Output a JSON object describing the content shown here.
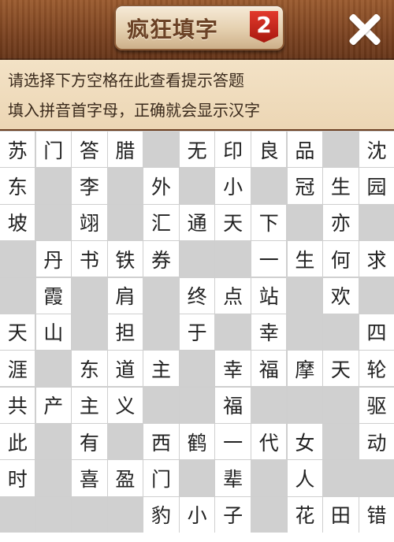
{
  "header": {
    "title": "疯狂填字",
    "badge": "2",
    "close_symbol": "✕"
  },
  "hints": {
    "line1": "请选择下方空格在此查看提示答题",
    "line2": "填入拼音首字母，正确就会显示汉字"
  },
  "grid": {
    "rows": [
      [
        "苏",
        "门",
        "答",
        "腊",
        "",
        "无",
        "印",
        "良",
        "品",
        "",
        "沈"
      ],
      [
        "东",
        "",
        "李",
        "",
        "外",
        "",
        "小",
        "",
        "冠",
        "生",
        "园"
      ],
      [
        "坡",
        "",
        "翊",
        "",
        "汇",
        "通",
        "天",
        "下",
        "",
        "亦",
        ""
      ],
      [
        "",
        "丹",
        "书",
        "铁",
        "券",
        "",
        "",
        "一",
        "生",
        "何",
        "求"
      ],
      [
        "",
        "霞",
        "",
        "肩",
        "",
        "终",
        "点",
        "站",
        "",
        "欢",
        ""
      ],
      [
        "天",
        "山",
        "",
        "担",
        "",
        "于",
        "",
        "幸",
        "",
        "",
        "四"
      ],
      [
        "涯",
        "",
        "东",
        "道",
        "主",
        "",
        "幸",
        "福",
        "摩",
        "天",
        "轮"
      ],
      [
        "共",
        "产",
        "主",
        "义",
        "",
        "",
        "福",
        "",
        "",
        "",
        "驱"
      ],
      [
        "此",
        "",
        "有",
        "",
        "西",
        "鹤",
        "一",
        "代",
        "女",
        "",
        "动"
      ],
      [
        "时",
        "",
        "喜",
        "盈",
        "门",
        "",
        "辈",
        "",
        "人",
        "",
        ""
      ],
      [
        "",
        "",
        "",
        "",
        "豹",
        "小",
        "子",
        "",
        "花",
        "田",
        "错"
      ]
    ]
  }
}
